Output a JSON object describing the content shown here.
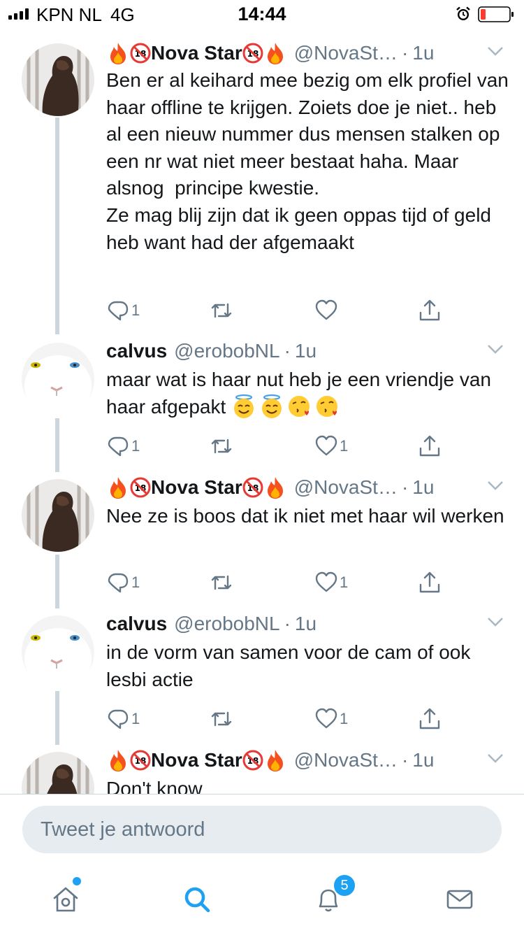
{
  "status_bar": {
    "carrier": "KPN NL",
    "network": "4G",
    "time": "14:44",
    "battery_color": "#ff3b30"
  },
  "tweets": [
    {
      "author_type": "nova",
      "name": "Nova Star",
      "handle": "@NovaSt…",
      "time": "1u",
      "text": "Ben er al keihard mee bezig om elk profiel van haar offline te krijgen. Zoiets doe je niet.. heb al een nieuw nummer dus mensen stalken op een nr wat niet meer bestaat haha. Maar alsnog  principe kwestie.\nZe mag blij zijn dat ik geen oppas tijd of geld heb want had der afgemaakt",
      "replies": "1",
      "likes": ""
    },
    {
      "author_type": "calvus",
      "name": "calvus",
      "handle": "@erobobNL",
      "time": "1u",
      "text": "maar wat is haar nut heb je een vriendje van haar afgepakt",
      "text_emojis": [
        "smiling-face-with-halo",
        "smiling-face-with-halo",
        "face-blowing-kiss",
        "face-blowing-kiss"
      ],
      "replies": "1",
      "likes": "1"
    },
    {
      "author_type": "nova",
      "name": "Nova Star",
      "handle": "@NovaSt…",
      "time": "1u",
      "text": "Nee ze is boos dat ik niet met haar wil werken",
      "replies": "1",
      "likes": "1"
    },
    {
      "author_type": "calvus",
      "name": "calvus",
      "handle": "@erobobNL",
      "time": "1u",
      "text": "in de vorm van samen voor de cam of ook lesbi actie",
      "replies": "1",
      "likes": "1"
    },
    {
      "author_type": "nova",
      "name": "Nova Star",
      "handle": "@NovaSt…",
      "time": "1u",
      "text": "Don't know"
    }
  ],
  "reply": {
    "placeholder": "Tweet je antwoord"
  },
  "tabbar": {
    "notifications_badge": "5",
    "accent": "#1da1f2"
  },
  "icons": {
    "name_decorations": [
      "fire-emoji",
      "no-one-under-18-emoji",
      "no-one-under-18-emoji",
      "fire-emoji"
    ],
    "actions": [
      "reply-icon",
      "retweet-icon",
      "like-icon",
      "share-icon"
    ],
    "tabs": [
      "home-icon",
      "search-icon",
      "notifications-icon",
      "messages-icon"
    ]
  }
}
